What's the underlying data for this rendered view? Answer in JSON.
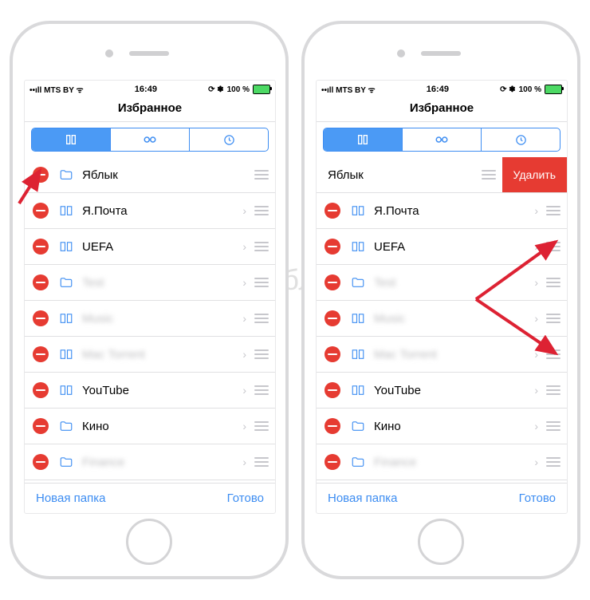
{
  "status": {
    "carrier": "MTS BY",
    "bars": "••ıll",
    "time": "16:49",
    "battery_pct": "100 %",
    "bt": "⚡ ⌁"
  },
  "nav": {
    "title": "Избранное"
  },
  "segmented": {
    "tabs": [
      "bookmarks",
      "reading-list",
      "history"
    ],
    "active": 0
  },
  "toolbar": {
    "new_folder": "Новая папка",
    "done": "Готово"
  },
  "delete_label": "Удалить",
  "left_phone": {
    "items": [
      {
        "type": "folder",
        "title": "Яблык",
        "chevron": false
      },
      {
        "type": "bookmark",
        "title": "Я.Почта",
        "chevron": true
      },
      {
        "type": "bookmark",
        "title": "UEFA",
        "chevron": true
      },
      {
        "type": "folder",
        "title": "Test",
        "chevron": true,
        "blurred": true
      },
      {
        "type": "bookmark",
        "title": "Music",
        "chevron": true,
        "blurred": true
      },
      {
        "type": "bookmark",
        "title": "Mac Torrent",
        "chevron": true,
        "blurred": true
      },
      {
        "type": "bookmark",
        "title": "YouTube",
        "chevron": true
      },
      {
        "type": "folder",
        "title": "Кино",
        "chevron": true
      },
      {
        "type": "folder",
        "title": "Finance",
        "chevron": true,
        "blurred": true
      }
    ]
  },
  "right_phone": {
    "items": [
      {
        "type": "swiped",
        "title": "Яблык",
        "chevron": false
      },
      {
        "type": "bookmark",
        "title": "Я.Почта",
        "chevron": true
      },
      {
        "type": "bookmark",
        "title": "UEFA",
        "chevron": true
      },
      {
        "type": "folder",
        "title": "Test",
        "chevron": true,
        "blurred": true
      },
      {
        "type": "bookmark",
        "title": "Music",
        "chevron": true,
        "blurred": true
      },
      {
        "type": "bookmark",
        "title": "Mac Torrent",
        "chevron": true,
        "blurred": true
      },
      {
        "type": "bookmark",
        "title": "YouTube",
        "chevron": true
      },
      {
        "type": "folder",
        "title": "Кино",
        "chevron": true
      },
      {
        "type": "folder",
        "title": "Finance",
        "chevron": true,
        "blurred": true
      }
    ]
  },
  "watermark": "Яблык"
}
